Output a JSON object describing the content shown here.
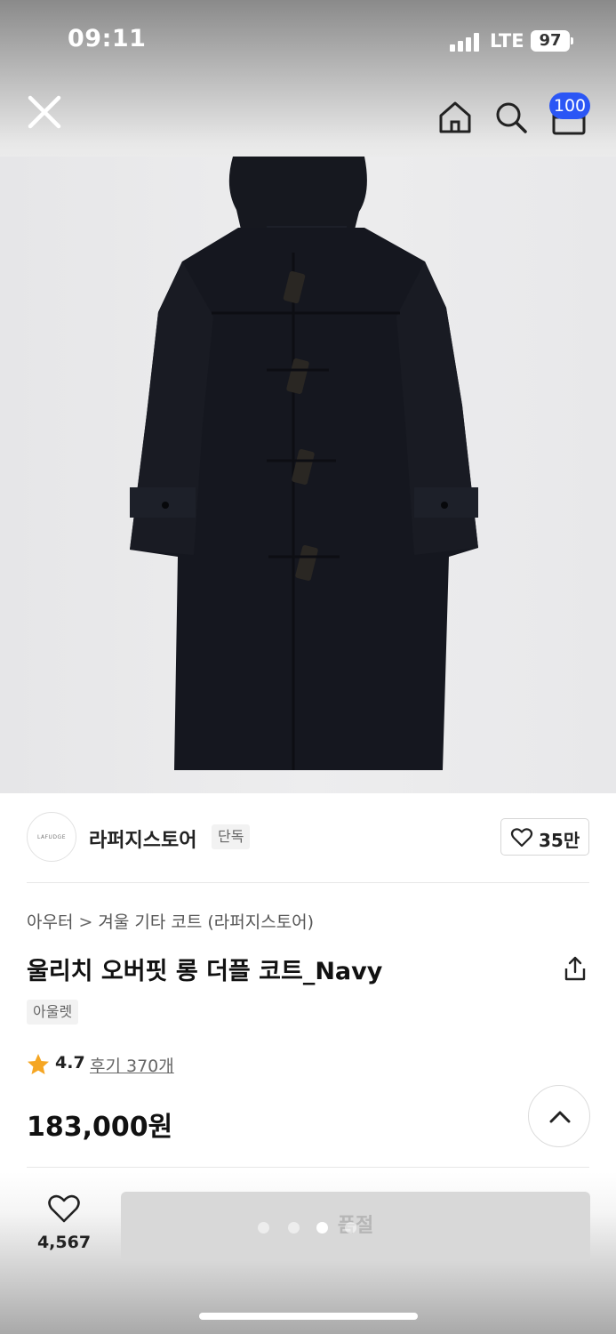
{
  "status_bar": {
    "time": "09:11",
    "network": "LTE",
    "battery": "97"
  },
  "nav": {
    "close_icon": "close-icon",
    "home_icon": "home-icon",
    "search_icon": "search-icon",
    "bag_icon": "shopping-bag-icon",
    "cart_badge": "100",
    "badge_color": "#2b56f5"
  },
  "gallery": {
    "image_subject": "navy duffle coat",
    "pages_total": 4,
    "active_page": 3
  },
  "store": {
    "name": "라퍼지스토어",
    "exclusive_badge": "단독",
    "likes": "35만",
    "logo_text": "LAFUDGE"
  },
  "product": {
    "breadcrumb": [
      "아우터",
      "겨울 기타 코트 (라퍼지스토어)"
    ],
    "title": "울리치 오버핏 롱 더플 코트_Navy",
    "tag": "아울렛",
    "rating": "4.7",
    "reviews": "후기 370개",
    "price": "183,000원"
  },
  "bottom_bar": {
    "wish_count": "4,567",
    "purchase_button": "품절"
  },
  "colors": {
    "accent": "#2b56f5",
    "star": "#f5a623",
    "coat": "#15171f"
  }
}
